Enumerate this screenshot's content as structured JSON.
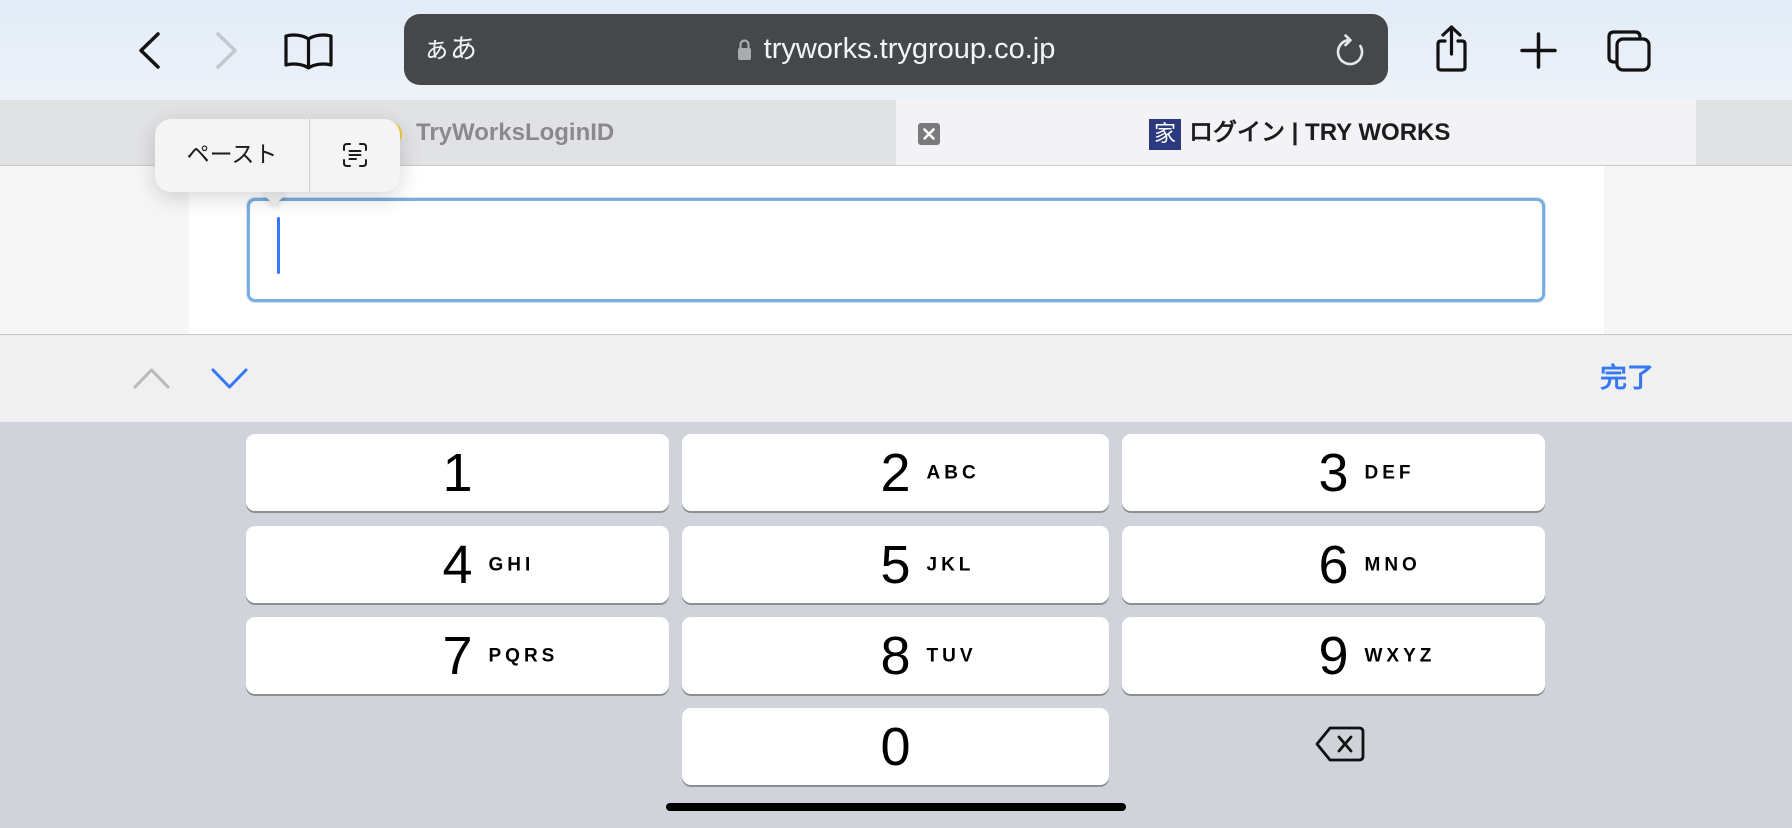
{
  "colors": {
    "accent": "#3478f6",
    "address_bar_bg": "#45484b",
    "keyboard_bg": "#d0d4da",
    "favicon_bg": "#2b3a80",
    "field_border": "#7aaee0"
  },
  "toolbar": {
    "back_icon": "chevron-left-icon",
    "forward_icon": "chevron-right-icon",
    "bookmarks_icon": "book-icon",
    "share_icon": "share-icon",
    "new_tab_icon": "plus-icon",
    "tabs_icon": "tabs-overview-icon"
  },
  "address_bar": {
    "text_size_label": "ぁあ",
    "lock_icon": "lock-icon",
    "url": "tryworks.trygroup.co.jp",
    "reload_icon": "reload-icon"
  },
  "tabs": [
    {
      "title": "TryWorksLoginID",
      "active": false
    },
    {
      "title": "ログイン | TRY WORKS",
      "active": true,
      "favicon_text": "家",
      "close_icon": "close-icon"
    }
  ],
  "edit_menu": {
    "paste_label": "ペースト",
    "scan_text_icon": "scan-text-icon"
  },
  "accessory_bar": {
    "prev_icon": "chevron-up-icon",
    "next_icon": "chevron-down-icon",
    "done_label": "完了"
  },
  "keypad": {
    "keys": [
      {
        "digit": "1",
        "letters": ""
      },
      {
        "digit": "2",
        "letters": "ABC"
      },
      {
        "digit": "3",
        "letters": "DEF"
      },
      {
        "digit": "4",
        "letters": "GHI"
      },
      {
        "digit": "5",
        "letters": "JKL"
      },
      {
        "digit": "6",
        "letters": "MNO"
      },
      {
        "digit": "7",
        "letters": "PQRS"
      },
      {
        "digit": "8",
        "letters": "TUV"
      },
      {
        "digit": "9",
        "letters": "WXYZ"
      },
      {
        "digit": "0",
        "letters": ""
      }
    ],
    "delete_icon": "delete-backward-icon"
  }
}
